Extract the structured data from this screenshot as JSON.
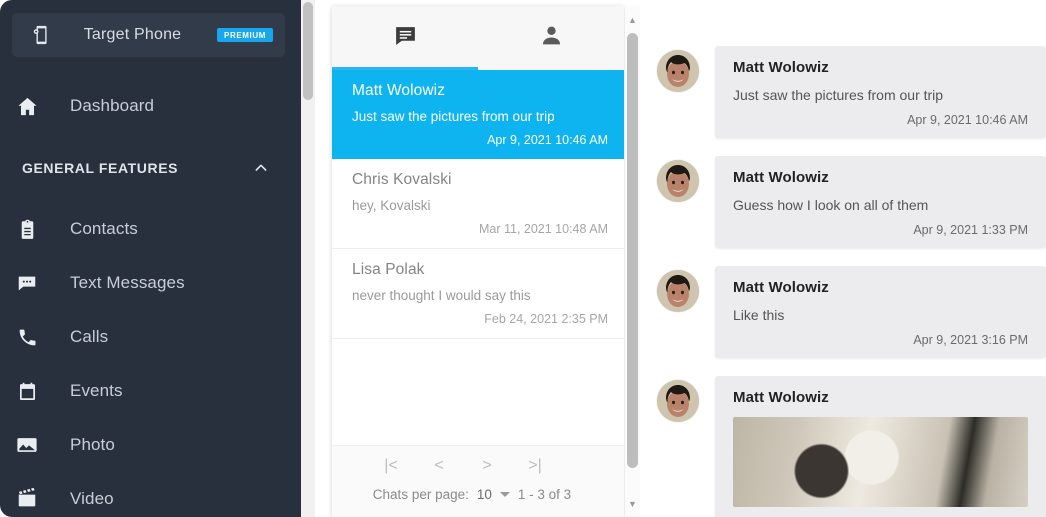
{
  "sidebar": {
    "target_phone": {
      "icon": "phone-settings-icon",
      "title": "Target Phone",
      "badge": "PREMIUM"
    },
    "dashboard": {
      "icon": "home-icon",
      "label": "Dashboard"
    },
    "section": {
      "title": "GENERAL FEATURES",
      "chevron": "chevron-up-icon"
    },
    "items": [
      {
        "icon": "contacts-icon",
        "label": "Contacts"
      },
      {
        "icon": "text-messages-icon",
        "label": "Text Messages"
      },
      {
        "icon": "calls-icon",
        "label": "Calls"
      },
      {
        "icon": "events-icon",
        "label": "Events"
      },
      {
        "icon": "photo-icon",
        "label": "Photo"
      },
      {
        "icon": "video-icon",
        "label": "Video"
      }
    ]
  },
  "chat_panel": {
    "tabs": [
      {
        "icon": "chat-icon",
        "name": "chats",
        "active": true
      },
      {
        "icon": "person-icon",
        "name": "contacts",
        "active": false
      }
    ],
    "chats": [
      {
        "name": "Matt Wolowiz",
        "preview": "Just saw the pictures from our trip",
        "time": "Apr 9, 2021 10:46 AM",
        "selected": true
      },
      {
        "name": "Chris Kovalski",
        "preview": "hey, Kovalski",
        "time": "Mar 11, 2021 10:48 AM",
        "selected": false
      },
      {
        "name": "Lisa Polak",
        "preview": "never thought I would say this",
        "time": "Feb 24, 2021 2:35 PM",
        "selected": false
      }
    ],
    "paginator": {
      "first_label": "|<",
      "prev_label": "<",
      "next_label": ">",
      "last_label": ">|",
      "per_page_label": "Chats per page:",
      "per_page_value": "10",
      "range_label": "1 - 3 of 3"
    }
  },
  "messages": [
    {
      "avatar": "avatar-matt",
      "name": "Matt Wolowiz",
      "text": "Just saw the pictures from our trip",
      "time": "Apr 9, 2021 10:46 AM",
      "has_image": false
    },
    {
      "avatar": "avatar-matt",
      "name": "Matt Wolowiz",
      "text": "Guess how I look on all of them",
      "time": "Apr 9, 2021 1:33 PM",
      "has_image": false
    },
    {
      "avatar": "avatar-matt",
      "name": "Matt Wolowiz",
      "text": "Like this",
      "time": "Apr 9, 2021 3:16 PM",
      "has_image": false
    },
    {
      "avatar": "avatar-matt",
      "name": "Matt Wolowiz",
      "text": "",
      "time": "",
      "has_image": true
    }
  ],
  "colors": {
    "sidebar_bg": "#28303d",
    "accent_blue": "#0db4ef",
    "badge_blue": "#17a7ed",
    "bubble_bg": "#ececee"
  }
}
